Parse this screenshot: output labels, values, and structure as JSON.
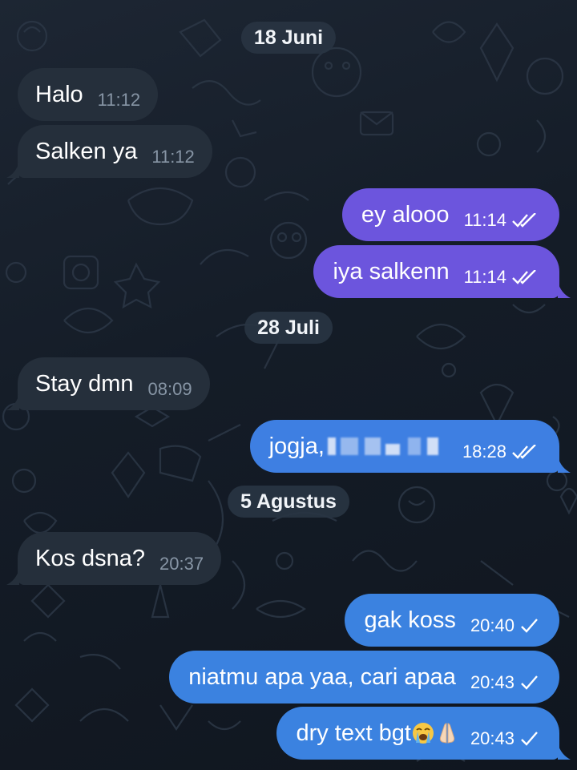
{
  "dates": [
    "18 Juni",
    "28 Juli",
    "5 Agustus"
  ],
  "messages": [
    {
      "text": "Halo",
      "time": "11:12",
      "dir": "in"
    },
    {
      "text": "Salken ya",
      "time": "11:12",
      "dir": "in"
    },
    {
      "text": "ey alooo",
      "time": "11:14",
      "dir": "out",
      "status": "read"
    },
    {
      "text": "iya salkenn",
      "time": "11:14",
      "dir": "out",
      "status": "read"
    },
    {
      "text": "Stay dmn",
      "time": "08:09",
      "dir": "in"
    },
    {
      "text": "jogja,",
      "time": "18:28",
      "dir": "out",
      "status": "read",
      "redacted": true
    },
    {
      "text": "Kos dsna?",
      "time": "20:37",
      "dir": "in"
    },
    {
      "text": "gak koss",
      "time": "20:40",
      "dir": "out",
      "status": "sent"
    },
    {
      "text": "niatmu apa yaa, cari apaa",
      "time": "20:43",
      "dir": "out",
      "status": "sent"
    },
    {
      "text": "dry text bgt",
      "time": "20:43",
      "dir": "out",
      "status": "sent",
      "emoji": [
        "loudly-crying-face",
        "folded-hands"
      ]
    }
  ],
  "colors": {
    "incoming": "#252f3b",
    "outgoing_purple": "#6c55dd",
    "outgoing_blue": "#3b82e0",
    "date_pill": "#28343f"
  }
}
